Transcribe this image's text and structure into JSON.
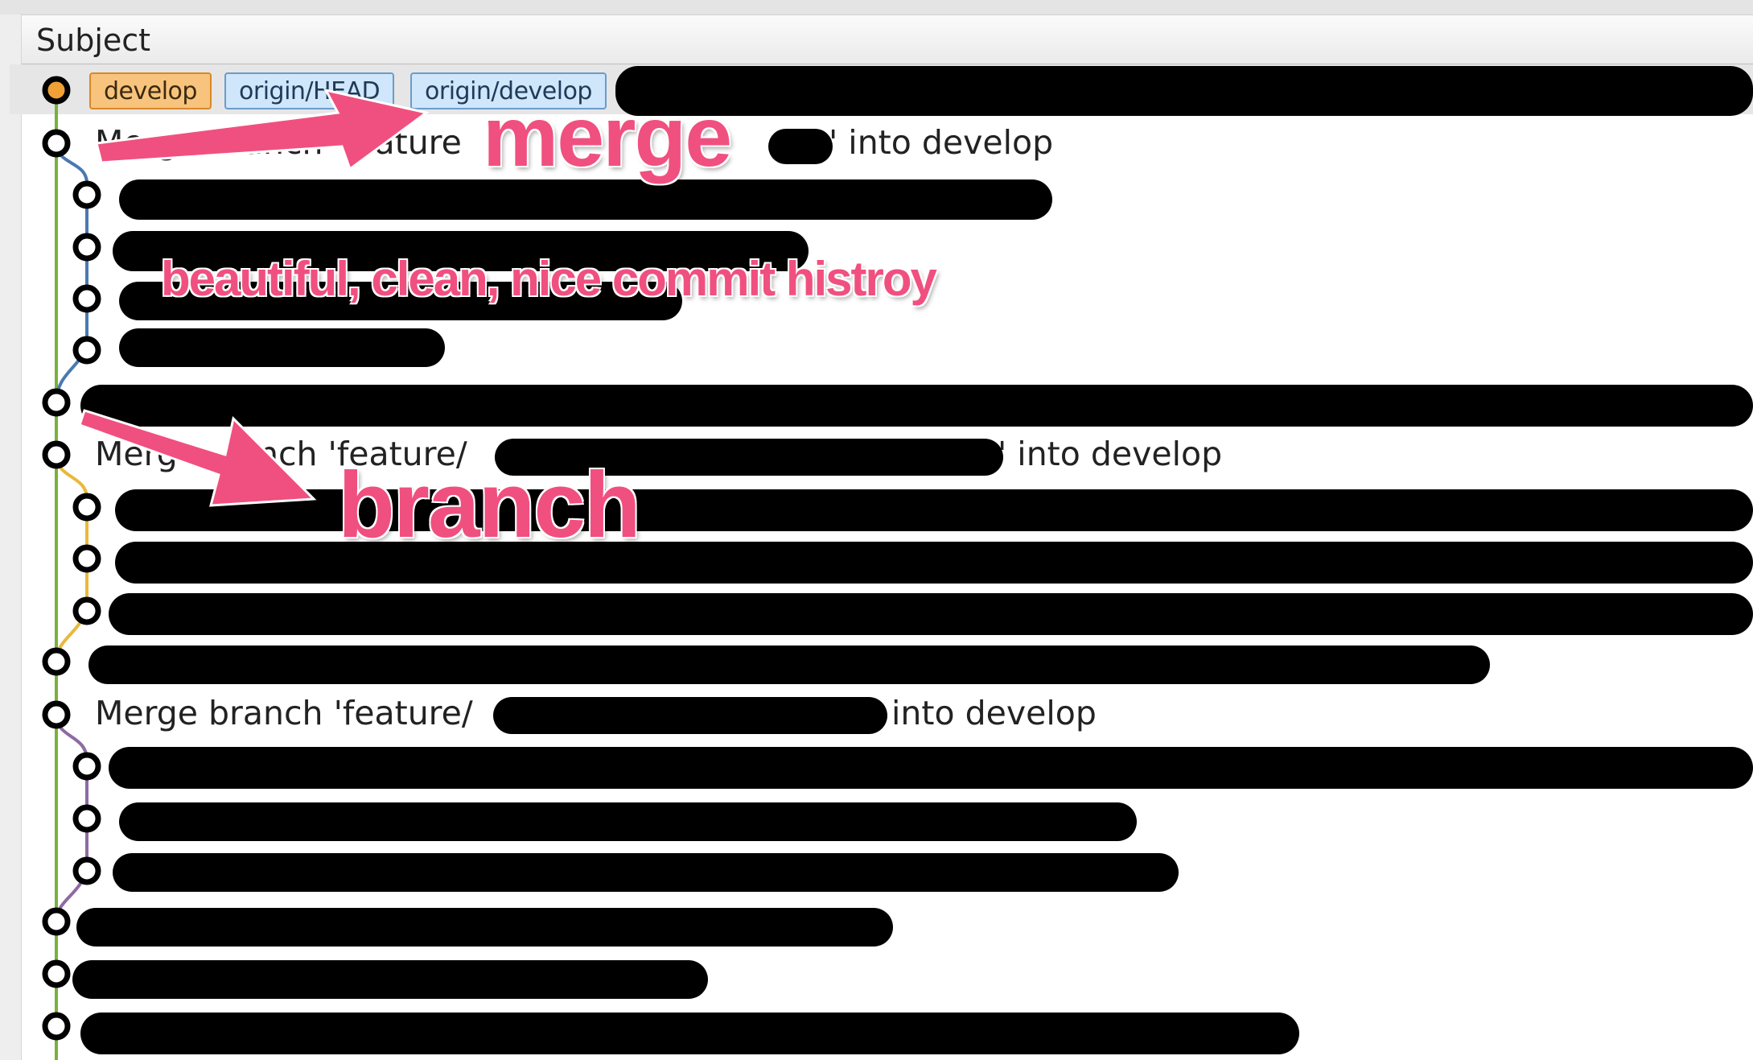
{
  "header": {
    "subject_label": "Subject"
  },
  "refs": {
    "develop": "develop",
    "origin_head": "origin/HEAD",
    "origin_develop": "origin/develop"
  },
  "commits": {
    "merge1_prefix": "Merge branch 'feature",
    "merge1_suffix": "' into develop",
    "merge2_prefix": "Merg",
    "merge2_middle": "nch 'feature/",
    "merge2_suffix": "' into develop",
    "merge3_prefix": "Merge branch 'feature/",
    "merge3_suffix": " into develop"
  },
  "annotations": {
    "merge": "merge",
    "branch": "branch",
    "caption": "beautiful, clean, nice commit histroy"
  },
  "colors": {
    "annotation": "#f0507f",
    "lane_main": "#79b13c",
    "lane_branch1": "#4a79b0",
    "lane_branch2": "#e8b93a",
    "lane_branch3": "#8e6aa3",
    "head_node": "#f0a035"
  },
  "icons": {
    "commit_node": "commit-node-icon",
    "head_node": "head-commit-node-icon",
    "arrow": "annotation-arrow-icon"
  }
}
